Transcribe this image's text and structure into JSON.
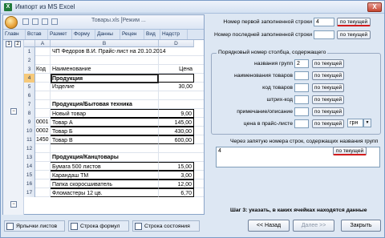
{
  "window": {
    "title": "Импорт из MS Excel",
    "close_label": "X"
  },
  "excel": {
    "doc_title": "Товары.xls [Режим ...",
    "ribbon_tabs": [
      "Главн",
      "Встав",
      "Размет",
      "Форму",
      "Данны",
      "Рецен",
      "Вид",
      "Надстр"
    ],
    "columns": [
      "A",
      "B",
      "D"
    ],
    "level_buttons": [
      "1",
      "2"
    ],
    "rows": [
      {
        "n": "1",
        "a": "",
        "b": "ЧП Федоров В.И.    Прайс-лист   на 20.10.2014",
        "d": "",
        "bold": false,
        "boxed": false
      },
      {
        "n": "2",
        "a": "",
        "b": "",
        "d": "",
        "bold": false,
        "boxed": false
      },
      {
        "n": "3",
        "a": "Код",
        "b": "Наименование",
        "d": "Цена",
        "bold": false,
        "boxed": false
      },
      {
        "n": "4",
        "a": "",
        "b": "Продукция",
        "d": "",
        "bold": true,
        "boxed": true
      },
      {
        "n": "5",
        "a": "",
        "b": "Изделие",
        "d": "30,00",
        "bold": false,
        "boxed": false
      },
      {
        "n": "6",
        "a": "",
        "b": "",
        "d": "",
        "bold": false,
        "boxed": false
      },
      {
        "n": "7",
        "a": "",
        "b": "Продукция/Бытовая техника",
        "d": "",
        "bold": true,
        "boxed": false
      },
      {
        "n": "8",
        "a": "",
        "b": "Новый товар",
        "d": "9,00",
        "bold": false,
        "boxed": true
      },
      {
        "n": "9",
        "a": "0001",
        "b": "Товар А",
        "d": "145,00",
        "bold": false,
        "boxed": true
      },
      {
        "n": "10",
        "a": "0002",
        "b": "Товар Б",
        "d": "430,00",
        "bold": false,
        "boxed": true
      },
      {
        "n": "11",
        "a": "1450",
        "b": "Товар В",
        "d": "600,00",
        "bold": false,
        "boxed": true
      },
      {
        "n": "12",
        "a": "",
        "b": "",
        "d": "",
        "bold": false,
        "boxed": false
      },
      {
        "n": "13",
        "a": "",
        "b": "Продукция/Канцтовары",
        "d": "",
        "bold": true,
        "boxed": false
      },
      {
        "n": "14",
        "a": "",
        "b": "Бумага 500 листов",
        "d": "15,00",
        "bold": false,
        "boxed": true
      },
      {
        "n": "15",
        "a": "",
        "b": "Карандаш ТМ",
        "d": "3,00",
        "bold": false,
        "boxed": true
      },
      {
        "n": "16",
        "a": "",
        "b": "Папка скоросшиватель",
        "d": "12,00",
        "bold": false,
        "boxed": true
      },
      {
        "n": "17",
        "a": "",
        "b": "Фломастеры 12 цв.",
        "d": "6,70",
        "bold": false,
        "boxed": true
      }
    ]
  },
  "settings": {
    "first_row_label": "Номер первой заполненной строки",
    "first_row_value": "4",
    "last_row_label": "Номер последней заполненной строки",
    "last_row_value": "",
    "current_btn": "по текущей",
    "columns_group_title": "Порядковый номер столбца, содержащего",
    "column_fields": [
      {
        "label": "названия групп",
        "value": "2"
      },
      {
        "label": "наименования товаров",
        "value": ""
      },
      {
        "label": "код товаров",
        "value": ""
      },
      {
        "label": "штрих-код",
        "value": ""
      },
      {
        "label": "примечание/описание",
        "value": ""
      },
      {
        "label": "цена в прайс-листе",
        "value": ""
      }
    ],
    "currency_value": "грн",
    "groups_rows_label": "Через запятую номера строк, содержащих названия групп",
    "groups_rows_value": "4"
  },
  "footer": {
    "chk_sheets": "Ярлычки листов",
    "chk_formula": "Строка формул",
    "chk_status": "Строка состояния",
    "hint": "Шаг 3: указать, в каких ячейках находятся данные",
    "back_btn": "<< Назад",
    "next_btn": "Далее >>",
    "close_btn": "Закрыть"
  }
}
